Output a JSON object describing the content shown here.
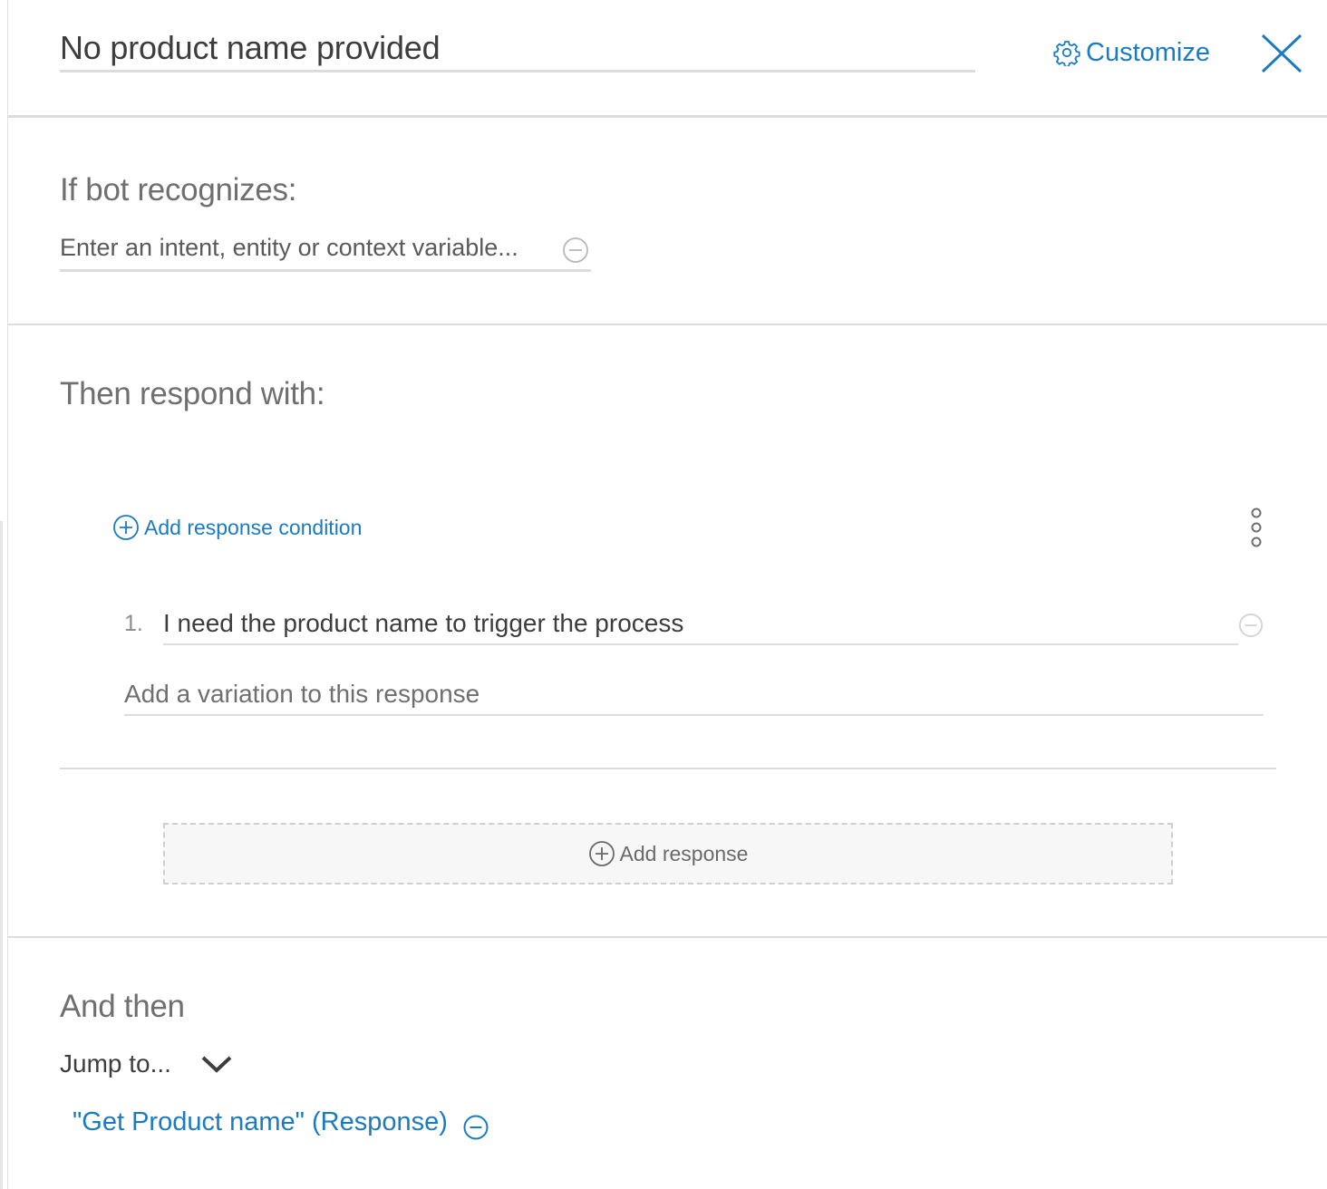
{
  "header": {
    "node_name": "No product name provided",
    "customize_label": "Customize"
  },
  "condition_section": {
    "heading": "If bot recognizes:",
    "input_placeholder": "Enter an intent, entity or context variable..."
  },
  "response_section": {
    "heading": "Then respond with:",
    "add_condition_label": "Add response condition",
    "responses": [
      {
        "number": "1.",
        "text": "I need the product name to trigger the process"
      }
    ],
    "variation_placeholder": "Add a variation to this response",
    "add_response_label": "Add response"
  },
  "and_then_section": {
    "heading": "And then",
    "action_label": "Jump to...",
    "jump_target": "\"Get Product name\" (Response)"
  },
  "colors": {
    "accent": "#1b7bc0",
    "divider": "#dcdcdc",
    "heading_text": "#6f6f6f"
  },
  "icons": [
    "gear-icon",
    "close-icon",
    "minus-circle-icon",
    "plus-circle-icon",
    "kebab-menu-icon",
    "chevron-down-icon"
  ]
}
